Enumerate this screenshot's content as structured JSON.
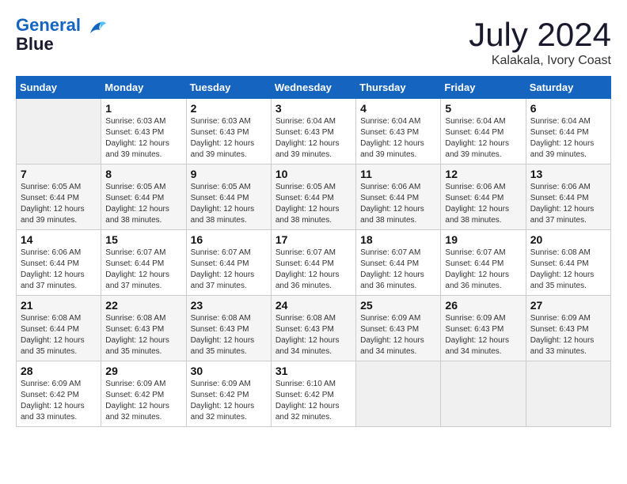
{
  "header": {
    "logo_line1": "General",
    "logo_line2": "Blue",
    "month": "July 2024",
    "location": "Kalakala, Ivory Coast"
  },
  "days_of_week": [
    "Sunday",
    "Monday",
    "Tuesday",
    "Wednesday",
    "Thursday",
    "Friday",
    "Saturday"
  ],
  "weeks": [
    [
      {
        "day": "",
        "empty": true
      },
      {
        "day": "1",
        "sunrise": "6:03 AM",
        "sunset": "6:43 PM",
        "daylight": "12 hours and 39 minutes."
      },
      {
        "day": "2",
        "sunrise": "6:03 AM",
        "sunset": "6:43 PM",
        "daylight": "12 hours and 39 minutes."
      },
      {
        "day": "3",
        "sunrise": "6:04 AM",
        "sunset": "6:43 PM",
        "daylight": "12 hours and 39 minutes."
      },
      {
        "day": "4",
        "sunrise": "6:04 AM",
        "sunset": "6:43 PM",
        "daylight": "12 hours and 39 minutes."
      },
      {
        "day": "5",
        "sunrise": "6:04 AM",
        "sunset": "6:44 PM",
        "daylight": "12 hours and 39 minutes."
      },
      {
        "day": "6",
        "sunrise": "6:04 AM",
        "sunset": "6:44 PM",
        "daylight": "12 hours and 39 minutes."
      }
    ],
    [
      {
        "day": "7",
        "sunrise": "6:05 AM",
        "sunset": "6:44 PM",
        "daylight": "12 hours and 39 minutes."
      },
      {
        "day": "8",
        "sunrise": "6:05 AM",
        "sunset": "6:44 PM",
        "daylight": "12 hours and 38 minutes."
      },
      {
        "day": "9",
        "sunrise": "6:05 AM",
        "sunset": "6:44 PM",
        "daylight": "12 hours and 38 minutes."
      },
      {
        "day": "10",
        "sunrise": "6:05 AM",
        "sunset": "6:44 PM",
        "daylight": "12 hours and 38 minutes."
      },
      {
        "day": "11",
        "sunrise": "6:06 AM",
        "sunset": "6:44 PM",
        "daylight": "12 hours and 38 minutes."
      },
      {
        "day": "12",
        "sunrise": "6:06 AM",
        "sunset": "6:44 PM",
        "daylight": "12 hours and 38 minutes."
      },
      {
        "day": "13",
        "sunrise": "6:06 AM",
        "sunset": "6:44 PM",
        "daylight": "12 hours and 37 minutes."
      }
    ],
    [
      {
        "day": "14",
        "sunrise": "6:06 AM",
        "sunset": "6:44 PM",
        "daylight": "12 hours and 37 minutes."
      },
      {
        "day": "15",
        "sunrise": "6:07 AM",
        "sunset": "6:44 PM",
        "daylight": "12 hours and 37 minutes."
      },
      {
        "day": "16",
        "sunrise": "6:07 AM",
        "sunset": "6:44 PM",
        "daylight": "12 hours and 37 minutes."
      },
      {
        "day": "17",
        "sunrise": "6:07 AM",
        "sunset": "6:44 PM",
        "daylight": "12 hours and 36 minutes."
      },
      {
        "day": "18",
        "sunrise": "6:07 AM",
        "sunset": "6:44 PM",
        "daylight": "12 hours and 36 minutes."
      },
      {
        "day": "19",
        "sunrise": "6:07 AM",
        "sunset": "6:44 PM",
        "daylight": "12 hours and 36 minutes."
      },
      {
        "day": "20",
        "sunrise": "6:08 AM",
        "sunset": "6:44 PM",
        "daylight": "12 hours and 35 minutes."
      }
    ],
    [
      {
        "day": "21",
        "sunrise": "6:08 AM",
        "sunset": "6:44 PM",
        "daylight": "12 hours and 35 minutes."
      },
      {
        "day": "22",
        "sunrise": "6:08 AM",
        "sunset": "6:43 PM",
        "daylight": "12 hours and 35 minutes."
      },
      {
        "day": "23",
        "sunrise": "6:08 AM",
        "sunset": "6:43 PM",
        "daylight": "12 hours and 35 minutes."
      },
      {
        "day": "24",
        "sunrise": "6:08 AM",
        "sunset": "6:43 PM",
        "daylight": "12 hours and 34 minutes."
      },
      {
        "day": "25",
        "sunrise": "6:09 AM",
        "sunset": "6:43 PM",
        "daylight": "12 hours and 34 minutes."
      },
      {
        "day": "26",
        "sunrise": "6:09 AM",
        "sunset": "6:43 PM",
        "daylight": "12 hours and 34 minutes."
      },
      {
        "day": "27",
        "sunrise": "6:09 AM",
        "sunset": "6:43 PM",
        "daylight": "12 hours and 33 minutes."
      }
    ],
    [
      {
        "day": "28",
        "sunrise": "6:09 AM",
        "sunset": "6:42 PM",
        "daylight": "12 hours and 33 minutes."
      },
      {
        "day": "29",
        "sunrise": "6:09 AM",
        "sunset": "6:42 PM",
        "daylight": "12 hours and 32 minutes."
      },
      {
        "day": "30",
        "sunrise": "6:09 AM",
        "sunset": "6:42 PM",
        "daylight": "12 hours and 32 minutes."
      },
      {
        "day": "31",
        "sunrise": "6:10 AM",
        "sunset": "6:42 PM",
        "daylight": "12 hours and 32 minutes."
      },
      {
        "day": "",
        "empty": true
      },
      {
        "day": "",
        "empty": true
      },
      {
        "day": "",
        "empty": true
      }
    ]
  ]
}
